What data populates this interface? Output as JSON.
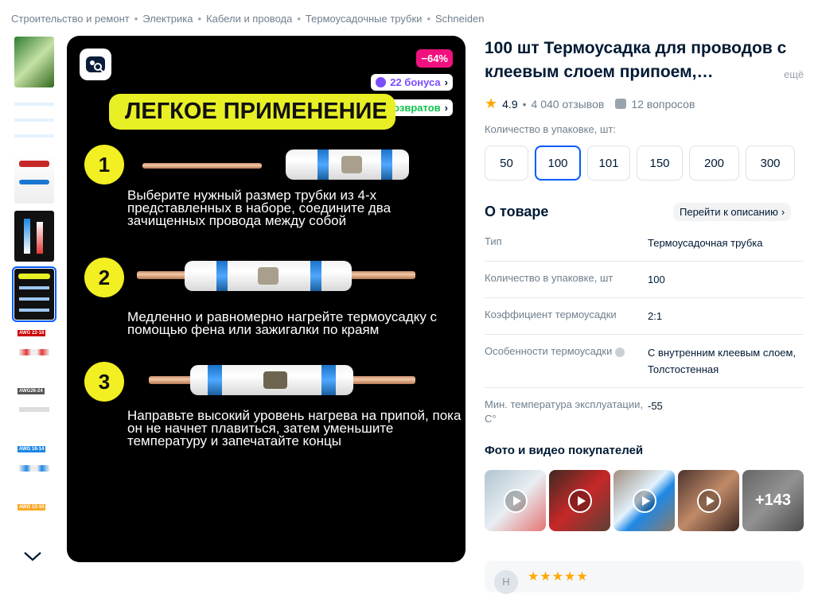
{
  "breadcrumbs": [
    "Строительство и ремонт",
    "Электрика",
    "Кабели и провода",
    "Термоусадочные трубки",
    "Schneiden"
  ],
  "thumbnail_labels": [
    "AWG 22-18",
    "AWG26-24",
    "AWG 16-14",
    "AWG 12-10"
  ],
  "main_image": {
    "discount": "−64%",
    "bonus": "22 бонуса",
    "returns": "0% возвратов",
    "heading": "ЛЕГКОЕ ПРИМЕНЕНИЕ",
    "steps": [
      {
        "num": "1",
        "text": "Выберите нужный размер трубки из 4-х представленных в наборе, соедините два зачищенных провода между собой"
      },
      {
        "num": "2",
        "text": "Медленно и равномерно нагрейте термоусадку с помощью фена или зажигалки по краям"
      },
      {
        "num": "3",
        "text": "Направьте высокий уровень нагрева на припой, пока он не начнет плавиться, затем уменьшите температуру и запечатайте концы"
      }
    ]
  },
  "product": {
    "title": "100 шт Термоусадка для проводов с клеевым слоем припоем,…",
    "more": "ещё",
    "rating": "4.9",
    "reviews": "4 040 отзывов",
    "questions": "12 вопросов"
  },
  "quantity": {
    "label": "Количество в упаковке, шт:",
    "options": [
      "50",
      "100",
      "101",
      "150",
      "200",
      "300"
    ],
    "selected": "100"
  },
  "about": {
    "title": "О товаре",
    "goto": "Перейти к описанию",
    "specs": [
      {
        "key": "Тип",
        "value": "Термоусадочная трубка"
      },
      {
        "key": "Количество в упаковке, шт",
        "value": "100"
      },
      {
        "key": "Коэффициент термоусадки",
        "value": "2:1"
      },
      {
        "key": "Особенности термоусадки",
        "value": "С внутренним клеевым слоем, Толстостенная"
      },
      {
        "key": "Мин. температура эксплуатации, С°",
        "value": "-55"
      }
    ]
  },
  "photos": {
    "title": "Фото и видео покупателей",
    "more_count": "+143"
  },
  "review": {
    "avatar": "Н",
    "stars": "★★★★★"
  },
  "colors": {
    "accent": "#005bff",
    "discount": "#f1117e",
    "bonus": "#7b4dff",
    "returns": "#10c44c",
    "star": "#ffa800"
  }
}
